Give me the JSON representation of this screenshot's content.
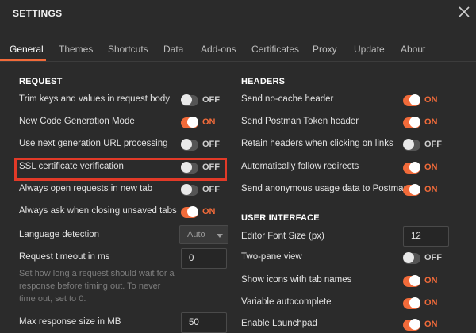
{
  "window": {
    "title": "SETTINGS"
  },
  "tabs": [
    {
      "label": "General",
      "active": true
    },
    {
      "label": "Themes"
    },
    {
      "label": "Shortcuts"
    },
    {
      "label": "Data"
    },
    {
      "label": "Add-ons"
    },
    {
      "label": "Certificates"
    },
    {
      "label": "Proxy"
    },
    {
      "label": "Update"
    },
    {
      "label": "About"
    }
  ],
  "request": {
    "heading": "REQUEST",
    "items": [
      {
        "label": "Trim keys and values in request body",
        "state": "OFF"
      },
      {
        "label": "New Code Generation Mode",
        "state": "ON"
      },
      {
        "label": "Use next generation URL processing",
        "state": "OFF"
      },
      {
        "label": "SSL certificate verification",
        "state": "OFF",
        "highlighted": true
      },
      {
        "label": "Always open requests in new tab",
        "state": "OFF"
      },
      {
        "label": "Always ask when closing unsaved tabs",
        "state": "ON"
      }
    ],
    "language_detection": {
      "label": "Language detection",
      "value": "Auto"
    },
    "timeout": {
      "label": "Request timeout in ms",
      "value": "0",
      "help": "Set how long a request should wait for a response before timing out. To never time out, set to 0."
    },
    "max_response": {
      "label": "Max response size in MB",
      "value": "50"
    }
  },
  "headers": {
    "heading": "HEADERS",
    "items": [
      {
        "label": "Send no-cache header",
        "state": "ON"
      },
      {
        "label": "Send Postman Token header",
        "state": "ON"
      },
      {
        "label": "Retain headers when clicking on links",
        "state": "OFF"
      },
      {
        "label": "Automatically follow redirects",
        "state": "ON"
      },
      {
        "label": "Send anonymous usage data to Postman",
        "state": "ON"
      }
    ]
  },
  "ui": {
    "heading": "USER INTERFACE",
    "font_size": {
      "label": "Editor Font Size (px)",
      "value": "12"
    },
    "items": [
      {
        "label": "Two-pane view",
        "state": "OFF"
      },
      {
        "label": "Show icons with tab names",
        "state": "ON"
      },
      {
        "label": "Variable autocomplete",
        "state": "ON"
      },
      {
        "label": "Enable Launchpad",
        "state": "ON"
      }
    ]
  },
  "colors": {
    "accent": "#f26b3a",
    "highlight_box": "#e23a28",
    "background": "#2b2b2b"
  }
}
